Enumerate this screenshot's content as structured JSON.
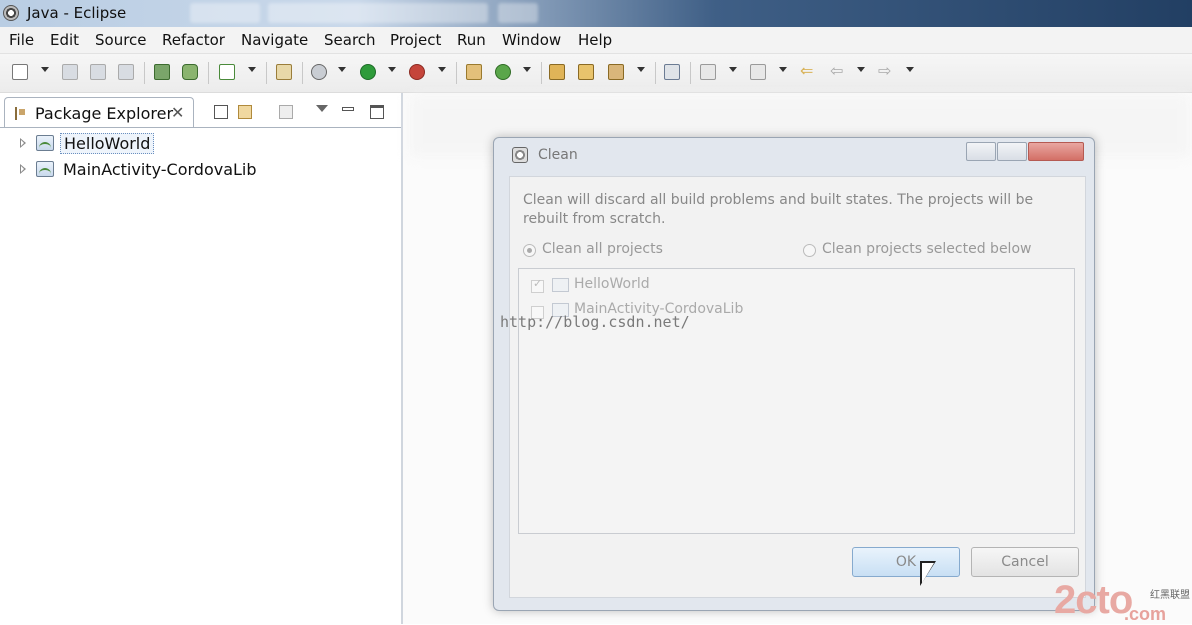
{
  "window": {
    "title": "Java - Eclipse"
  },
  "menu": [
    "File",
    "Edit",
    "Source",
    "Refactor",
    "Navigate",
    "Search",
    "Project",
    "Run",
    "Window",
    "Help"
  ],
  "toolbar": {
    "icons": [
      "new-icon",
      "save-icon",
      "save-all-icon",
      "print-icon",
      "import-icon",
      "export-icon",
      "task-icon",
      "open-type-icon",
      "debug-icon",
      "run-icon",
      "external-tools-icon",
      "new-class-icon",
      "refresh-icon",
      "open-folder-icon",
      "open-file-icon",
      "pin-icon",
      "annotation-icon",
      "next-annotation-icon",
      "prev-annotation-icon",
      "back-icon",
      "forward-icon"
    ]
  },
  "package_explorer": {
    "tab_label": "Package Explorer",
    "close_glyph": "✕",
    "items": [
      {
        "label": "HelloWorld",
        "selected": true
      },
      {
        "label": "MainActivity-CordovaLib",
        "selected": false
      }
    ]
  },
  "dialog": {
    "title": "Clean",
    "description": "Clean will discard all build problems and built states.  The projects will be rebuilt from scratch.",
    "option_all": "Clean all projects",
    "option_selected": "Clean projects selected below",
    "projects": [
      {
        "label": "HelloWorld",
        "checked": true
      },
      {
        "label": "MainActivity-CordovaLib",
        "checked": false
      }
    ],
    "ok_label": "OK",
    "cancel_label": "Cancel"
  },
  "watermark": "http://blog.csdn.net/",
  "brand": {
    "main": "2cto",
    "suffix": ".com",
    "cn": "红黑联盟"
  }
}
